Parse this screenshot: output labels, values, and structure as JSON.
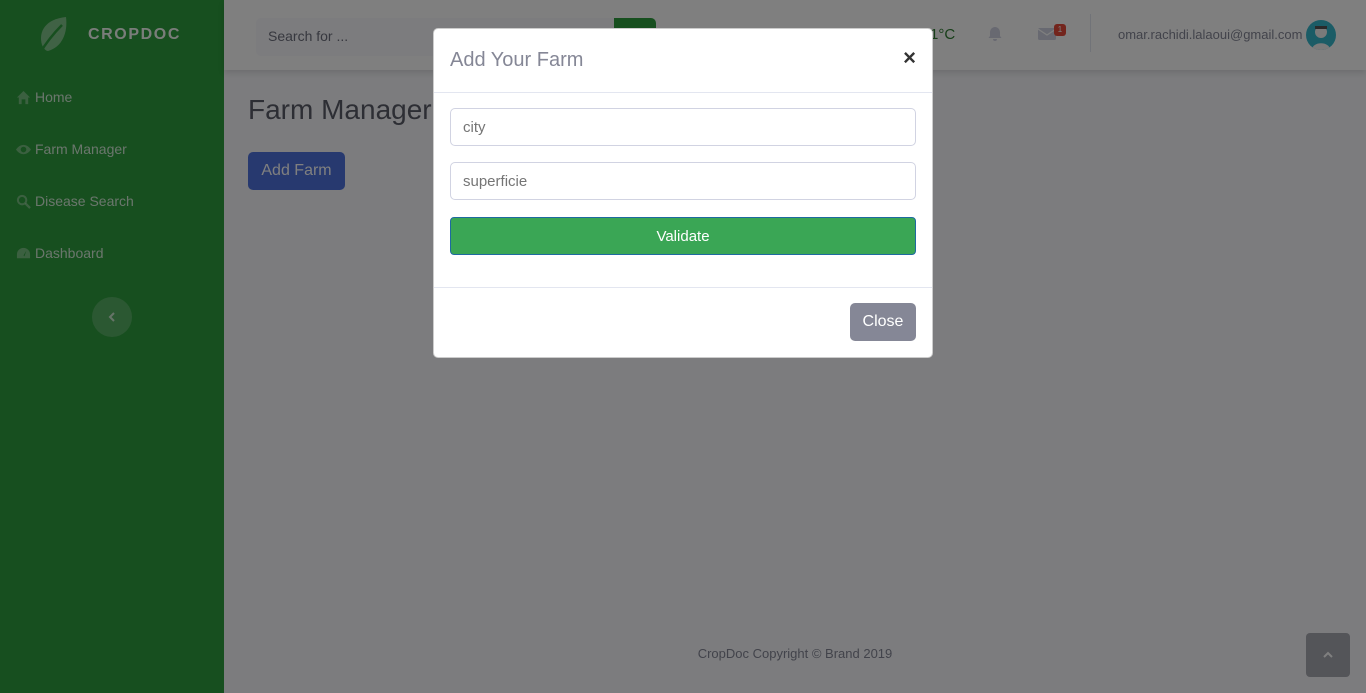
{
  "brand": {
    "name": "CROPDOC",
    "icon": "leaf-icon"
  },
  "sidebar": {
    "items": [
      {
        "label": "Home",
        "icon": "home-icon"
      },
      {
        "label": "Farm Manager",
        "icon": "eye-icon"
      },
      {
        "label": "Disease Search",
        "icon": "search-icon"
      },
      {
        "label": "Dashboard",
        "icon": "tachometer-icon"
      }
    ]
  },
  "topbar": {
    "search_placeholder": "Search for ...",
    "weather": "1°C",
    "mail_badge": "1",
    "user_email": "omar.rachidi.lalaoui@gmail.com"
  },
  "main": {
    "page_title": "Farm Manager",
    "add_farm_label": "Add Farm"
  },
  "modal": {
    "title": "Add Your Farm",
    "close_symbol": "×",
    "city_placeholder": "city",
    "superficie_placeholder": "superficie",
    "validate_label": "Validate",
    "close_label": "Close"
  },
  "footer": {
    "text": "CropDoc Copyright © Brand 2019"
  },
  "colors": {
    "sidebar": "#2e9e3e",
    "primary": "#4e73df",
    "success": "#3aa655",
    "secondary": "#858796"
  }
}
